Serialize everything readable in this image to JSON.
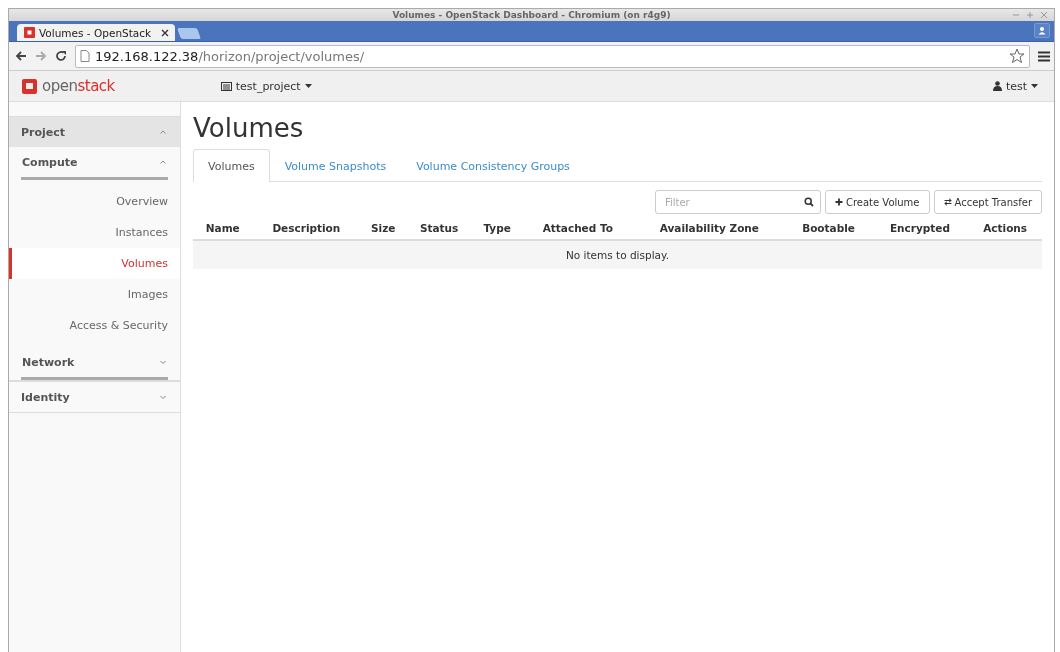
{
  "window": {
    "title": "Volumes - OpenStack Dashboard - Chromium (on r4g9)"
  },
  "browser": {
    "tabs": [
      {
        "title": "Volumes - OpenStack",
        "selected": true
      }
    ],
    "address": {
      "host": "192.168.122.38",
      "path": "/horizon/project/volumes/"
    }
  },
  "topbar": {
    "logo": [
      "open",
      "stack"
    ],
    "project": "test_project",
    "user": "test"
  },
  "sidebar": [
    {
      "label": "Project",
      "expanded": true,
      "children": [
        {
          "label": "Compute",
          "expanded": true,
          "children": [
            {
              "label": "Overview",
              "selected": false
            },
            {
              "label": "Instances",
              "selected": false
            },
            {
              "label": "Volumes",
              "selected": true
            },
            {
              "label": "Images",
              "selected": false
            },
            {
              "label": "Access & Security",
              "selected": false
            }
          ]
        },
        {
          "label": "Network",
          "expanded": false
        }
      ]
    },
    {
      "label": "Identity",
      "expanded": false
    }
  ],
  "page": {
    "title": "Volumes",
    "tabs": [
      {
        "label": "Volumes",
        "selected": true
      },
      {
        "label": "Volume Snapshots",
        "selected": false
      },
      {
        "label": "Volume Consistency Groups",
        "selected": false
      }
    ],
    "filter": {
      "placeholder": "Filter"
    },
    "actions": [
      {
        "kind": "create",
        "label": "Create Volume"
      },
      {
        "kind": "transfer",
        "label": "Accept Transfer"
      }
    ],
    "table": {
      "columns": [
        "Name",
        "Description",
        "Size",
        "Status",
        "Type",
        "Attached To",
        "Availability Zone",
        "Bootable",
        "Encrypted",
        "Actions"
      ],
      "empty_message": "No items to display."
    }
  }
}
